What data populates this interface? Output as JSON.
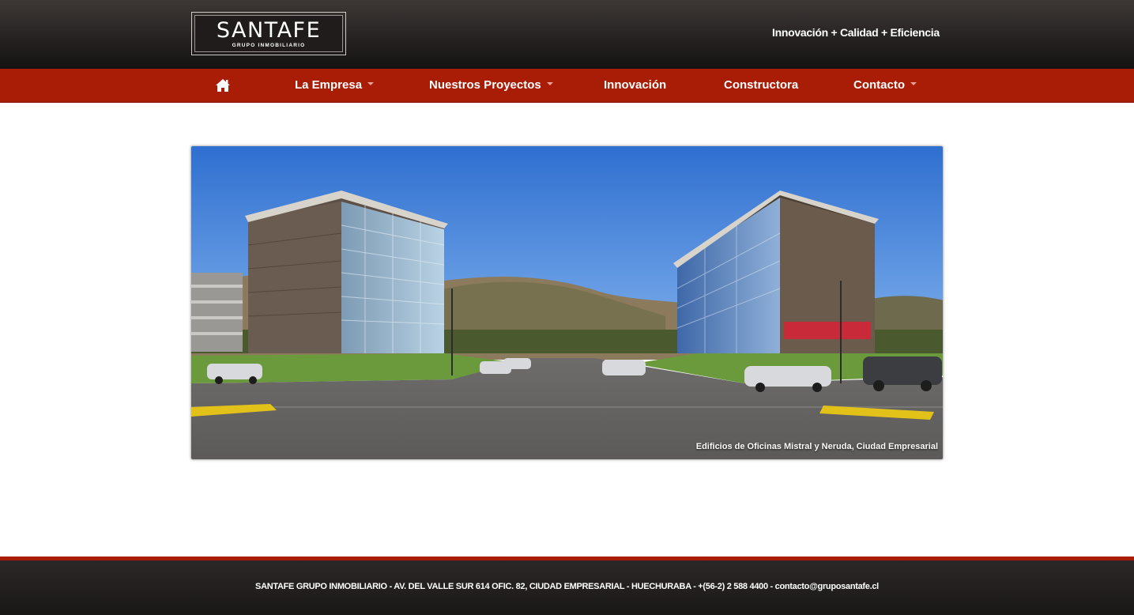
{
  "header": {
    "logo_text": "SANTAFE",
    "logo_subtext": "GRUPO INMOBILIARIO",
    "tagline": "Innovación + Calidad + Eficiencia"
  },
  "nav": {
    "home_icon": "home-icon",
    "items": [
      {
        "label": "La Empresa",
        "has_dropdown": true
      },
      {
        "label": "Nuestros Proyectos",
        "has_dropdown": true
      },
      {
        "label": "Innovación",
        "has_dropdown": false
      },
      {
        "label": "Constructora",
        "has_dropdown": false
      },
      {
        "label": "Contacto",
        "has_dropdown": true
      }
    ]
  },
  "hero": {
    "caption": "Edificios de Oficinas Mistral y Neruda, Ciudad Empresarial"
  },
  "footer": {
    "text": "SANTAFE GRUPO INMOBILIARIO - AV. DEL VALLE SUR 614 OFIC. 82, CIUDAD EMPRESARIAL - HUECHURABA - +(56-2) 2 588 4400 - ",
    "email": "contacto@gruposantafe.cl"
  },
  "colors": {
    "nav_red": "#a91c06",
    "header_dark": "#262322"
  }
}
